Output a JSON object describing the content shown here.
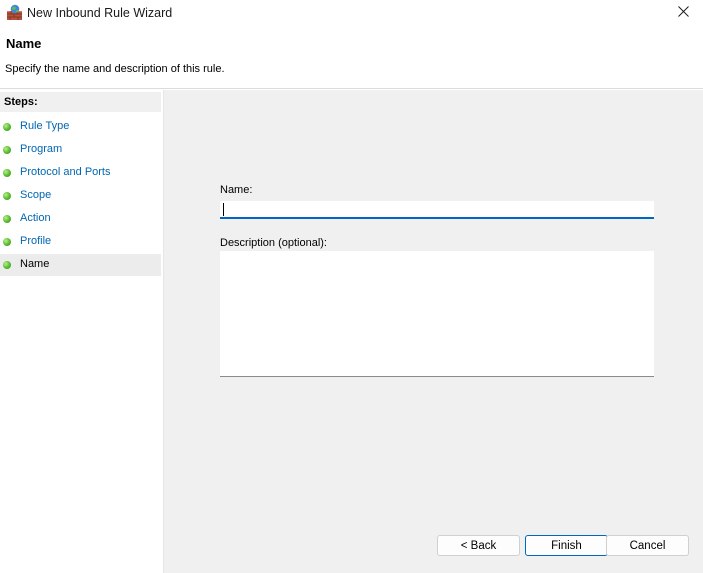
{
  "window": {
    "title": "New Inbound Rule Wizard",
    "icon": "firewall-app-icon",
    "close_icon": "close-icon"
  },
  "header": {
    "title": "Name",
    "subtitle": "Specify the name and description of this rule."
  },
  "steps": {
    "heading": "Steps:",
    "items": [
      {
        "label": "Rule Type",
        "active": false
      },
      {
        "label": "Program",
        "active": false
      },
      {
        "label": "Protocol and Ports",
        "active": false
      },
      {
        "label": "Scope",
        "active": false
      },
      {
        "label": "Action",
        "active": false
      },
      {
        "label": "Profile",
        "active": false
      },
      {
        "label": "Name",
        "active": true
      }
    ],
    "dot_color": "#57b82c",
    "link_color": "#0066b3"
  },
  "form": {
    "name_label": "Name:",
    "name_value": "",
    "description_label": "Description (optional):",
    "description_value": ""
  },
  "buttons": {
    "back": "< Back",
    "finish": "Finish",
    "cancel": "Cancel"
  },
  "colors": {
    "accent": "#0067c0",
    "pane_background": "#f0f0f0"
  }
}
